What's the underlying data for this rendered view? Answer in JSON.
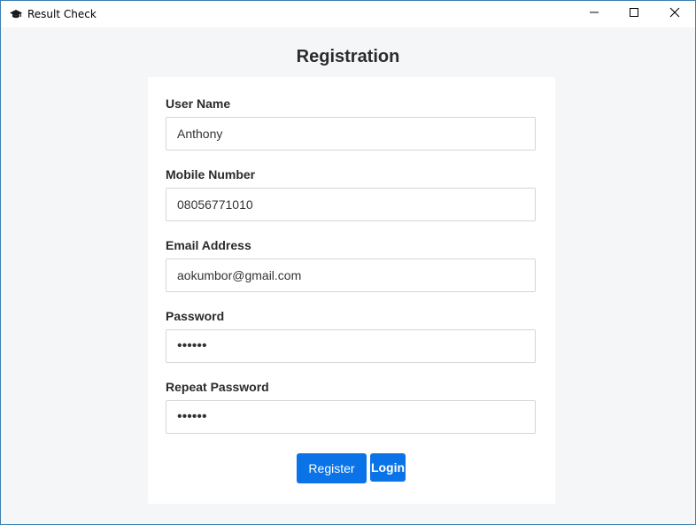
{
  "window": {
    "title": "Result Check",
    "icon": "graduation-cap-icon",
    "controls": [
      "minimize-icon",
      "maximize-icon",
      "close-icon"
    ]
  },
  "page": {
    "title": "Registration"
  },
  "form": {
    "username": {
      "label": "User Name",
      "value": "Anthony"
    },
    "mobile": {
      "label": "Mobile Number",
      "value": "08056771010"
    },
    "email": {
      "label": "Email Address",
      "value": "aokumbor@gmail.com"
    },
    "password": {
      "label": "Password",
      "value": "••••••"
    },
    "repeat_password": {
      "label": "Repeat Password",
      "value": "••••••"
    }
  },
  "actions": {
    "register_label": "Register",
    "login_label": "Login"
  },
  "colors": {
    "accent": "#0a73e8",
    "background": "#f5f6f8",
    "card": "#ffffff",
    "window_border": "#3c7fb1"
  }
}
